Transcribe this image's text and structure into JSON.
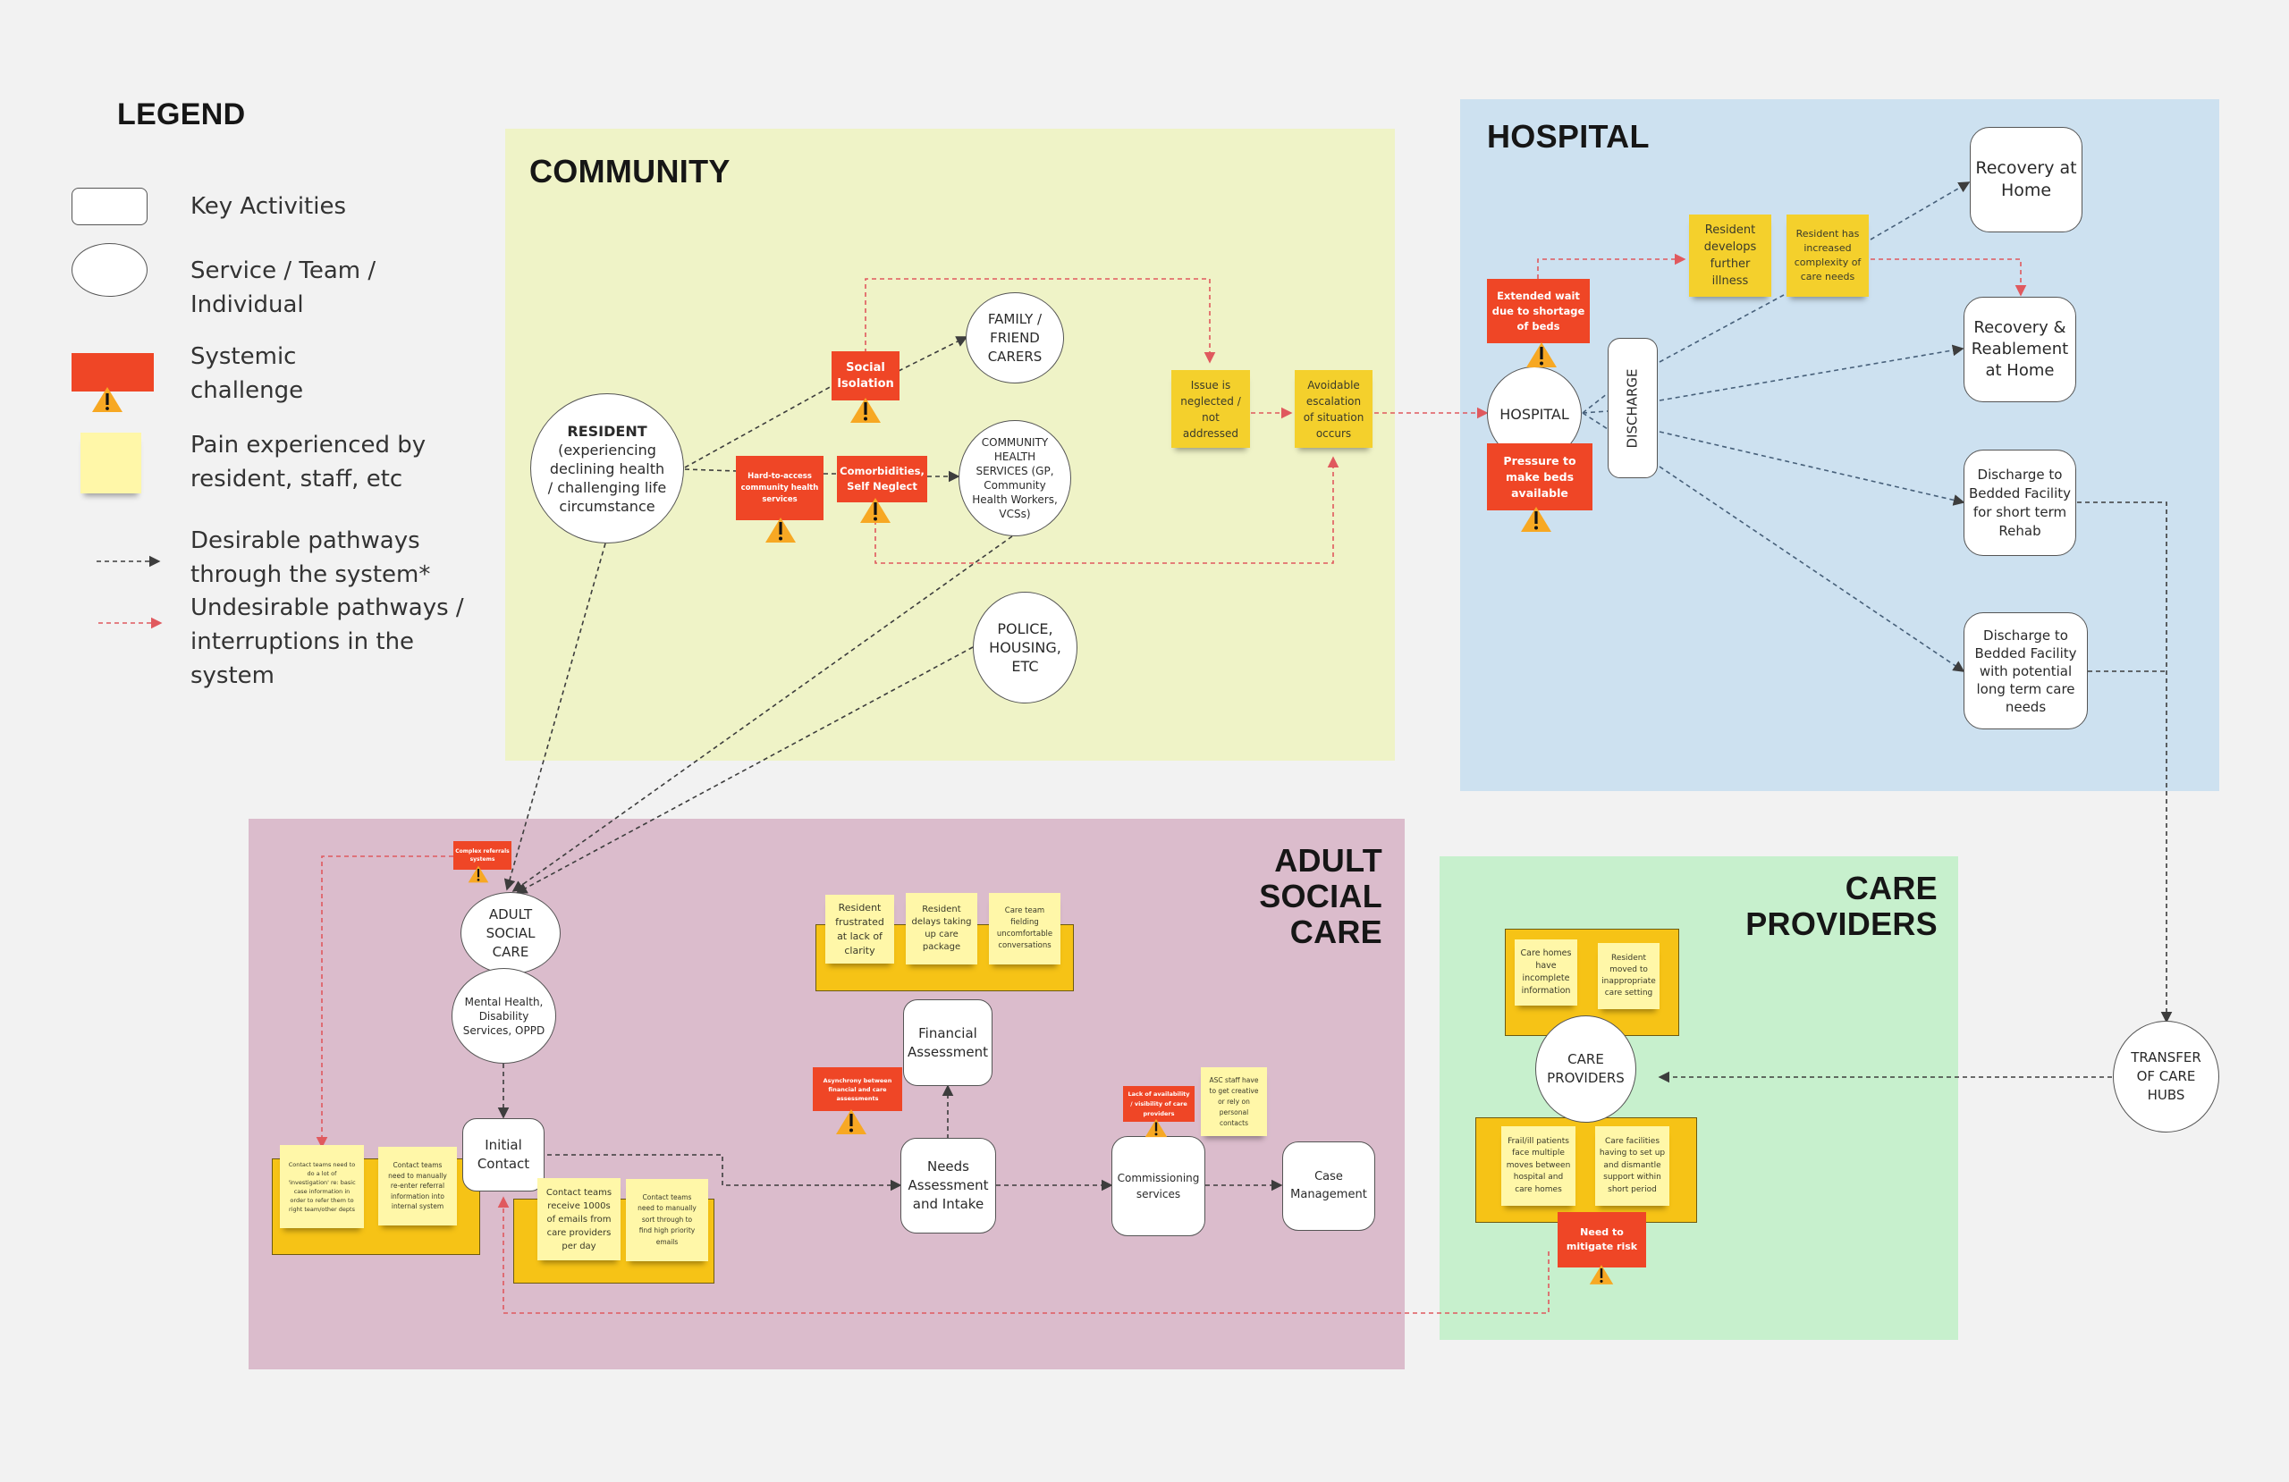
{
  "legend": {
    "title": "LEGEND",
    "items": [
      {
        "shape": "rounded-rect",
        "label": "Key Activities"
      },
      {
        "shape": "ellipse",
        "label": "Service / Team /\nIndividual"
      },
      {
        "shape": "red-box-warning",
        "label": "Systemic\nchallenge"
      },
      {
        "shape": "yellow-sticky",
        "label": "Pain experienced by\nresident, staff, etc"
      },
      {
        "shape": "dark-dashed-arrow",
        "label": "Desirable pathways\nthrough the system*"
      },
      {
        "shape": "red-dashed-arrow",
        "label": "Undesirable pathways /\ninterruptions in the\nsystem"
      }
    ]
  },
  "colors": {
    "community": "#eff3c7",
    "hospital": "#cde1f0",
    "adult_social_care": "#dbbccc",
    "care_providers": "#c7f0cd",
    "challenge": "#ef4626",
    "warning": "#f7a823",
    "pain_sticky": "#fff7a8",
    "pain_sticky_dark": "#f4d02c",
    "pain_group": "#f6c316",
    "desirable_path": "#3d3d3d",
    "undesirable_path": "#e0595e"
  },
  "regions": {
    "community": {
      "title": "COMMUNITY"
    },
    "hospital": {
      "title": "HOSPITAL"
    },
    "adult_social_care": {
      "title": "ADULT\nSOCIAL\nCARE"
    },
    "care_providers": {
      "title": "CARE\nPROVIDERS"
    }
  },
  "community": {
    "resident": {
      "title": "RESIDENT",
      "detail": "(experiencing\ndeclining health\n/ challenging life\ncircumstance"
    },
    "family_carers": "FAMILY /\nFRIEND\nCARERS",
    "community_health": "COMMUNITY\nHEALTH\nSERVICES (GP,\nCommunity\nHealth Workers,\nVCSs)",
    "police_housing": "POLICE,\nHOUSING,\nETC",
    "challenges": {
      "social_isolation": "Social\nIsolation",
      "hard_to_access": "Hard-to-access\ncommunity health\nservices",
      "comorbidities": "Comorbidities,\nSelf Neglect"
    },
    "pains": {
      "issue_neglected": "Issue is\nneglected /\nnot\naddressed",
      "avoidable_escalation": "Avoidable\nescalation\nof situation\noccurs"
    }
  },
  "hospital": {
    "hospital_node": "HOSPITAL",
    "discharge": "DISCHARGE",
    "challenges": {
      "extended_wait": "Extended wait\ndue to shortage\nof beds",
      "pressure_beds": "Pressure to\nmake beds\navailable"
    },
    "pains": {
      "further_illness": "Resident\ndevelops\nfurther\nillness",
      "increased_complexity": "Resident has\nincreased\ncomplexity of\ncare needs"
    },
    "outcomes": {
      "recovery_home": "Recovery at\nHome",
      "recovery_reablement": "Recovery &\nReablement\nat Home",
      "short_term_rehab": "Discharge to\nBedded Facility\nfor short term\nRehab",
      "long_term_care": "Discharge to\nBedded Facility\nwith potential\nlong term care\nneeds"
    }
  },
  "transfer_hubs": "TRANSFER\nOF CARE\nHUBS",
  "adult_social_care": {
    "asc_node": "ADULT\nSOCIAL\nCARE",
    "mental_health": "Mental Health,\nDisability\nServices, OPPD",
    "initial_contact": "Initial\nContact",
    "financial_assessment": "Financial\nAssessment",
    "needs_assessment": "Needs\nAssessment\nand Intake",
    "commissioning": "Commissioning\nservices",
    "case_management": "Case\nManagement",
    "challenges": {
      "complex_referrals": "Complex referrals\nsystems",
      "asynchrony": "Asynchrony between\nfinancial and care\nassessments",
      "lack_availability": "Lack of availability\n/ visibility of care\nproviders"
    },
    "pains": {
      "investigation": "Contact teams need to\ndo a lot of\n'investigation' re: basic\ncase information in\norder to refer them to\nright team/other depts",
      "re_enter": "Contact teams\nneed to manually\nre-enter referral\ninformation into\ninternal system",
      "emails_1000s": "Contact teams\nreceive 1000s\nof emails from\ncare providers\nper day",
      "sort_emails": "Contact teams\nneed to manually\nsort through to\nfind high priority\nemails",
      "frustrated": "Resident\nfrustrated\nat lack of\nclarity",
      "delays": "Resident\ndelays taking\nup care\npackage",
      "uncomfortable": "Care team\nfielding\nuncomfortable\nconversations",
      "asc_creative": "ASC staff have\nto get creative\nor rely on\npersonal\ncontacts"
    }
  },
  "care_providers": {
    "node": "CARE\nPROVIDERS",
    "challenges": {
      "mitigate_risk": "Need to\nmitigate risk"
    },
    "pains": {
      "incomplete_info": "Care homes\nhave\nincomplete\ninformation",
      "inappropriate_setting": "Resident\nmoved to\ninappropriate\ncare setting",
      "multiple_moves": "Frail/ill patients\nface multiple\nmoves between\nhospital and\ncare homes",
      "set_up_dismantle": "Care facilities\nhaving to set up\nand dismantle\nsupport within\nshort period"
    }
  }
}
